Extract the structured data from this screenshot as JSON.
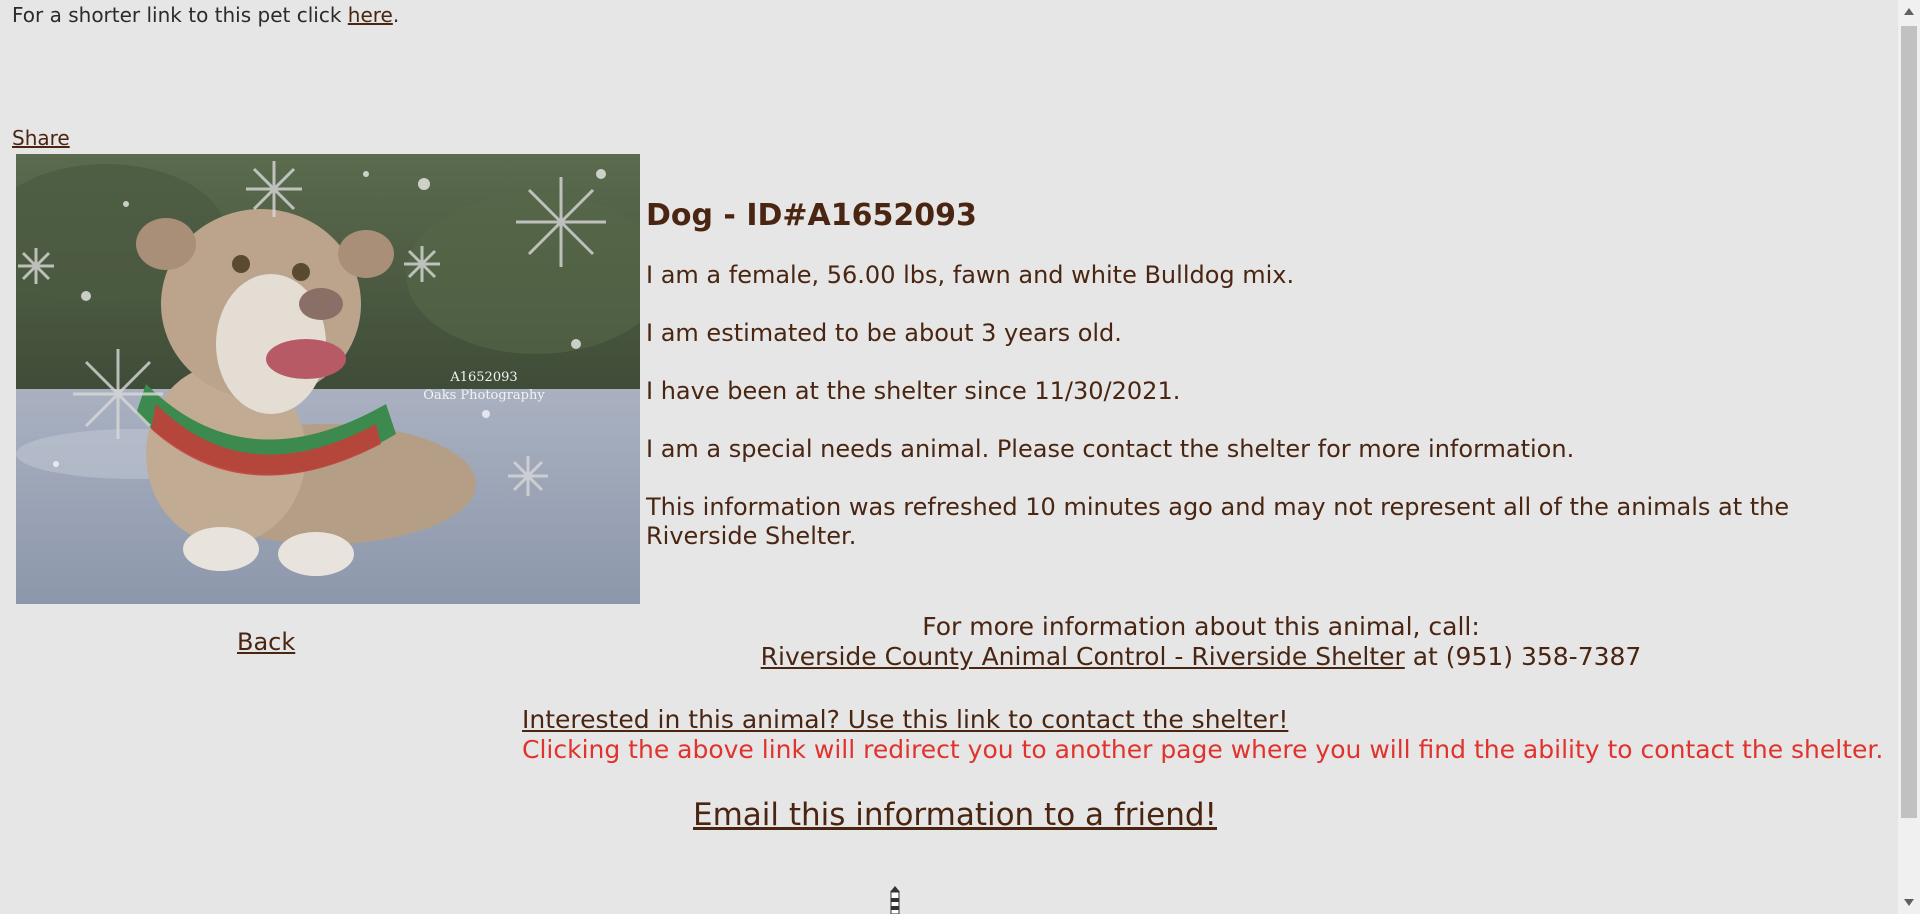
{
  "header": {
    "short_link_text": "For a shorter link to this pet click ",
    "short_link_label": "here",
    "short_link_suffix": "."
  },
  "share_label": "Share",
  "photo": {
    "watermark_id": "A1652093",
    "watermark_credit": "Oaks Photography"
  },
  "back_label": "Back",
  "animal": {
    "title": "Dog - ID#A1652093",
    "line_description": "I am a female, 56.00 lbs, fawn and white Bulldog mix.",
    "line_age": "I am estimated to be about 3 years old.",
    "line_since": "I have been at the shelter since 11/30/2021.",
    "line_special": "I am a special needs animal. Please contact the shelter for more information.",
    "line_refresh": "This information was refreshed 10 minutes ago and may not represent all of the animals at the Riverside Shelter."
  },
  "contact": {
    "intro": "For more information about this animal, call:",
    "shelter_link": "Riverside County Animal Control - Riverside Shelter",
    "phone_prefix": " at ",
    "phone": "(951) 358-7387"
  },
  "interest": {
    "link": "Interested in this animal? Use this link to contact the shelter!",
    "note": "Clicking the above link will redirect you to another page where you will find the ability to contact the shelter."
  },
  "email_label": "Email this information to a friend!",
  "colors": {
    "background": "#e6e6e6",
    "text_brown": "#4a2612",
    "note_red": "#e1332d"
  }
}
